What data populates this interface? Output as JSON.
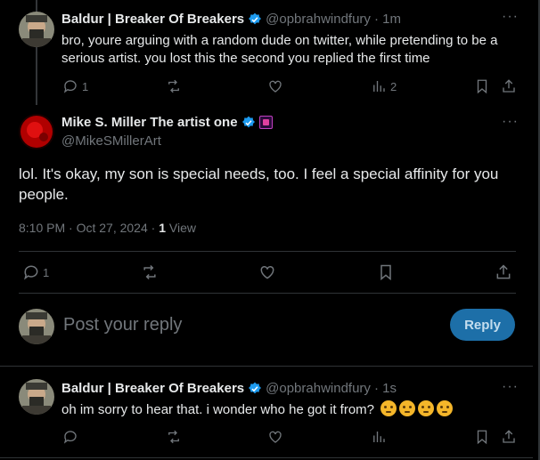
{
  "tweet1": {
    "name": "Baldur | Breaker Of Breakers",
    "handle": "@opbrahwindfury",
    "time": "· 1m",
    "text": "bro, youre arguing with a random dude on twitter, while pretending to be a serious artist. you lost this the second you replied the first time",
    "replies": "1",
    "views": "2"
  },
  "main": {
    "name": "Mike S. Miller The artist one",
    "handle": "@MikeSMillerArt",
    "text": "lol. It's okay, my son is special needs, too. I feel a special affinity for you people.",
    "timestamp": "8:10 PM · Oct 27, 2024 ·",
    "views_count": "1",
    "views_label": "View",
    "replies": "1"
  },
  "composer": {
    "placeholder": "Post your reply",
    "button": "Reply"
  },
  "tweet2": {
    "name": "Baldur | Breaker Of Breakers",
    "handle": "@opbrahwindfury",
    "time": "· 1s",
    "text": "oh im sorry to hear that. i wonder who he got it from?"
  },
  "icons": {
    "more": "more-icon",
    "reply": "reply-icon",
    "repost": "repost-icon",
    "like": "like-icon",
    "views": "views-icon",
    "bookmark": "bookmark-icon",
    "share": "share-icon",
    "verified": "verified-icon"
  },
  "colors": {
    "background": "#000000",
    "text": "#e7e9ea",
    "muted": "#71767b",
    "verified": "#1d9bf0",
    "reply_button": "#1d6fa8"
  }
}
